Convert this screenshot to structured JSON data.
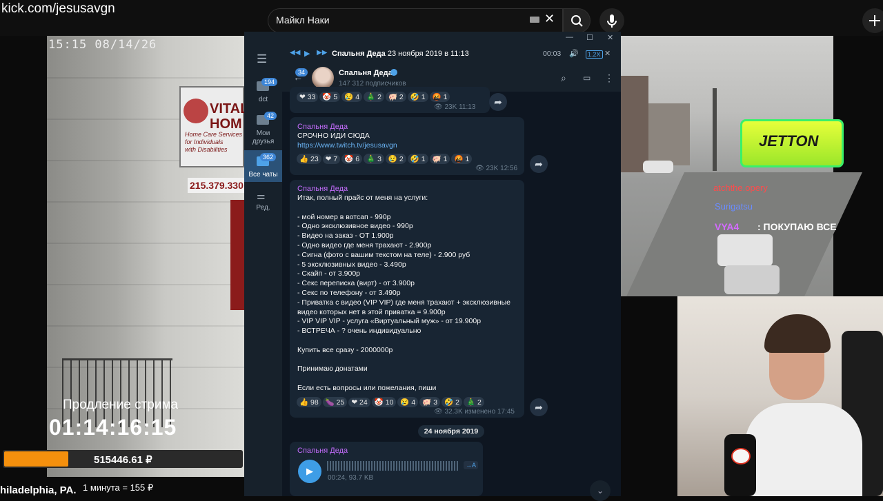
{
  "browser": {
    "url": "kick.com/jesusavgn",
    "search_query": "Майкл Наки"
  },
  "stream": {
    "camera_timestamp": "15:15  08/14/26",
    "sign_title": "VITAL\nHOM",
    "sign_sub": "Home Care Services\nfor Individuals\nwith Disabilities",
    "sign_phone": "215.379.330",
    "prolongation_label": "Продление стрима",
    "timer": "01:14:16:15",
    "donation_amount": "515446.61 ₽",
    "donation_progress_percent": 27,
    "location": "hiladelphia, PA.",
    "rate": "1 минута = 155 ₽",
    "sponsor": "JETTON",
    "chat": [
      {
        "user": "atchthe.opery",
        "message": ""
      },
      {
        "user": "Surigatsu",
        "message": ""
      },
      {
        "user": "VYA4",
        "message": ": ПОКУПАЮ ВСЕ"
      }
    ]
  },
  "telegram": {
    "player": {
      "track": "Спальня Деда",
      "date": "23 ноября 2019 в 11:13",
      "time": "00:03",
      "speed": "1.2X"
    },
    "channel": {
      "name": "Спальня Деда",
      "subscribers": "147 312 подписчиков",
      "unread_badge": "34"
    },
    "sidebar": [
      {
        "label": "dct",
        "badge": "194"
      },
      {
        "label": "Мои\nдрузья",
        "badge": "42"
      },
      {
        "label": "Все чаты",
        "badge": "362"
      },
      {
        "label": "Ред.",
        "badge": ""
      }
    ],
    "messages": {
      "m0": {
        "reactions": [
          "❤ 33",
          "🤡 5",
          "😢 4",
          "🎄 2",
          "🐖 2",
          "🤣 1",
          "🤬 1"
        ],
        "views": "23K",
        "time": "11:13"
      },
      "m1": {
        "author": "Спальня Деда",
        "text": "СРОЧНО ИДИ СЮДА",
        "link": "https://www.twitch.tv/jesusavgn",
        "reactions": [
          "👍 23",
          "❤ 7",
          "🤡 6",
          "🎄 3",
          "😢 2",
          "🤣 1",
          "🐖 1",
          "🤬 1"
        ],
        "views": "23K",
        "time": "12:56"
      },
      "m2": {
        "author": "Спальня Деда",
        "text": "Итак, полный прайс от меня на услуги:\n\n- мой номер в вотсап - 990р\n- Одно эксклюзивное видео - 990р\n- Видео на заказ - ОТ 1.900р\n- Одно видео где меня трахают - 2.900р\n- Сигна (фото с вашим текстом на теле) - 2.900 руб\n- 5 эксклюзивных видео - 3.490р\n- Скайп - от 3.900р\n- Секс переписка (вирт) - от 3.900р\n- Секс по телефону - от 3.490р\n- Приватка с видео (VIP VIP) где меня трахают + эксклюзивные\nвидео которых нет в этой приватка = 9.900р\n- VIP VIP VIP - услуга «Виртуальный муж» - от 19.900р\n- ВСТРЕЧА - ? очень индивидуально\n\nКупить все сразу - 2000000р\n\nПринимаю донатами\n\nЕсли есть вопросы или пожелания, пиши",
        "reactions": [
          "👍 98",
          "🍆 25",
          "❤ 24",
          "🤡 10",
          "😢 4",
          "🐖 3",
          "🤣 2",
          "🎄 2"
        ],
        "views": "32.3K",
        "time": "изменено 17:45"
      },
      "date_separator": "24 ноября 2019",
      "m3": {
        "author": "Спальня Деда",
        "duration": "00:24, 93.7 KB",
        "transcribe": "→A"
      }
    }
  },
  "colors": {
    "tg_bg": "#0e1621",
    "tg_panel": "#17212b",
    "tg_bubble": "#182533",
    "author": "#c46cfc",
    "link": "#6ab3f3",
    "donation": "#f5900d"
  }
}
